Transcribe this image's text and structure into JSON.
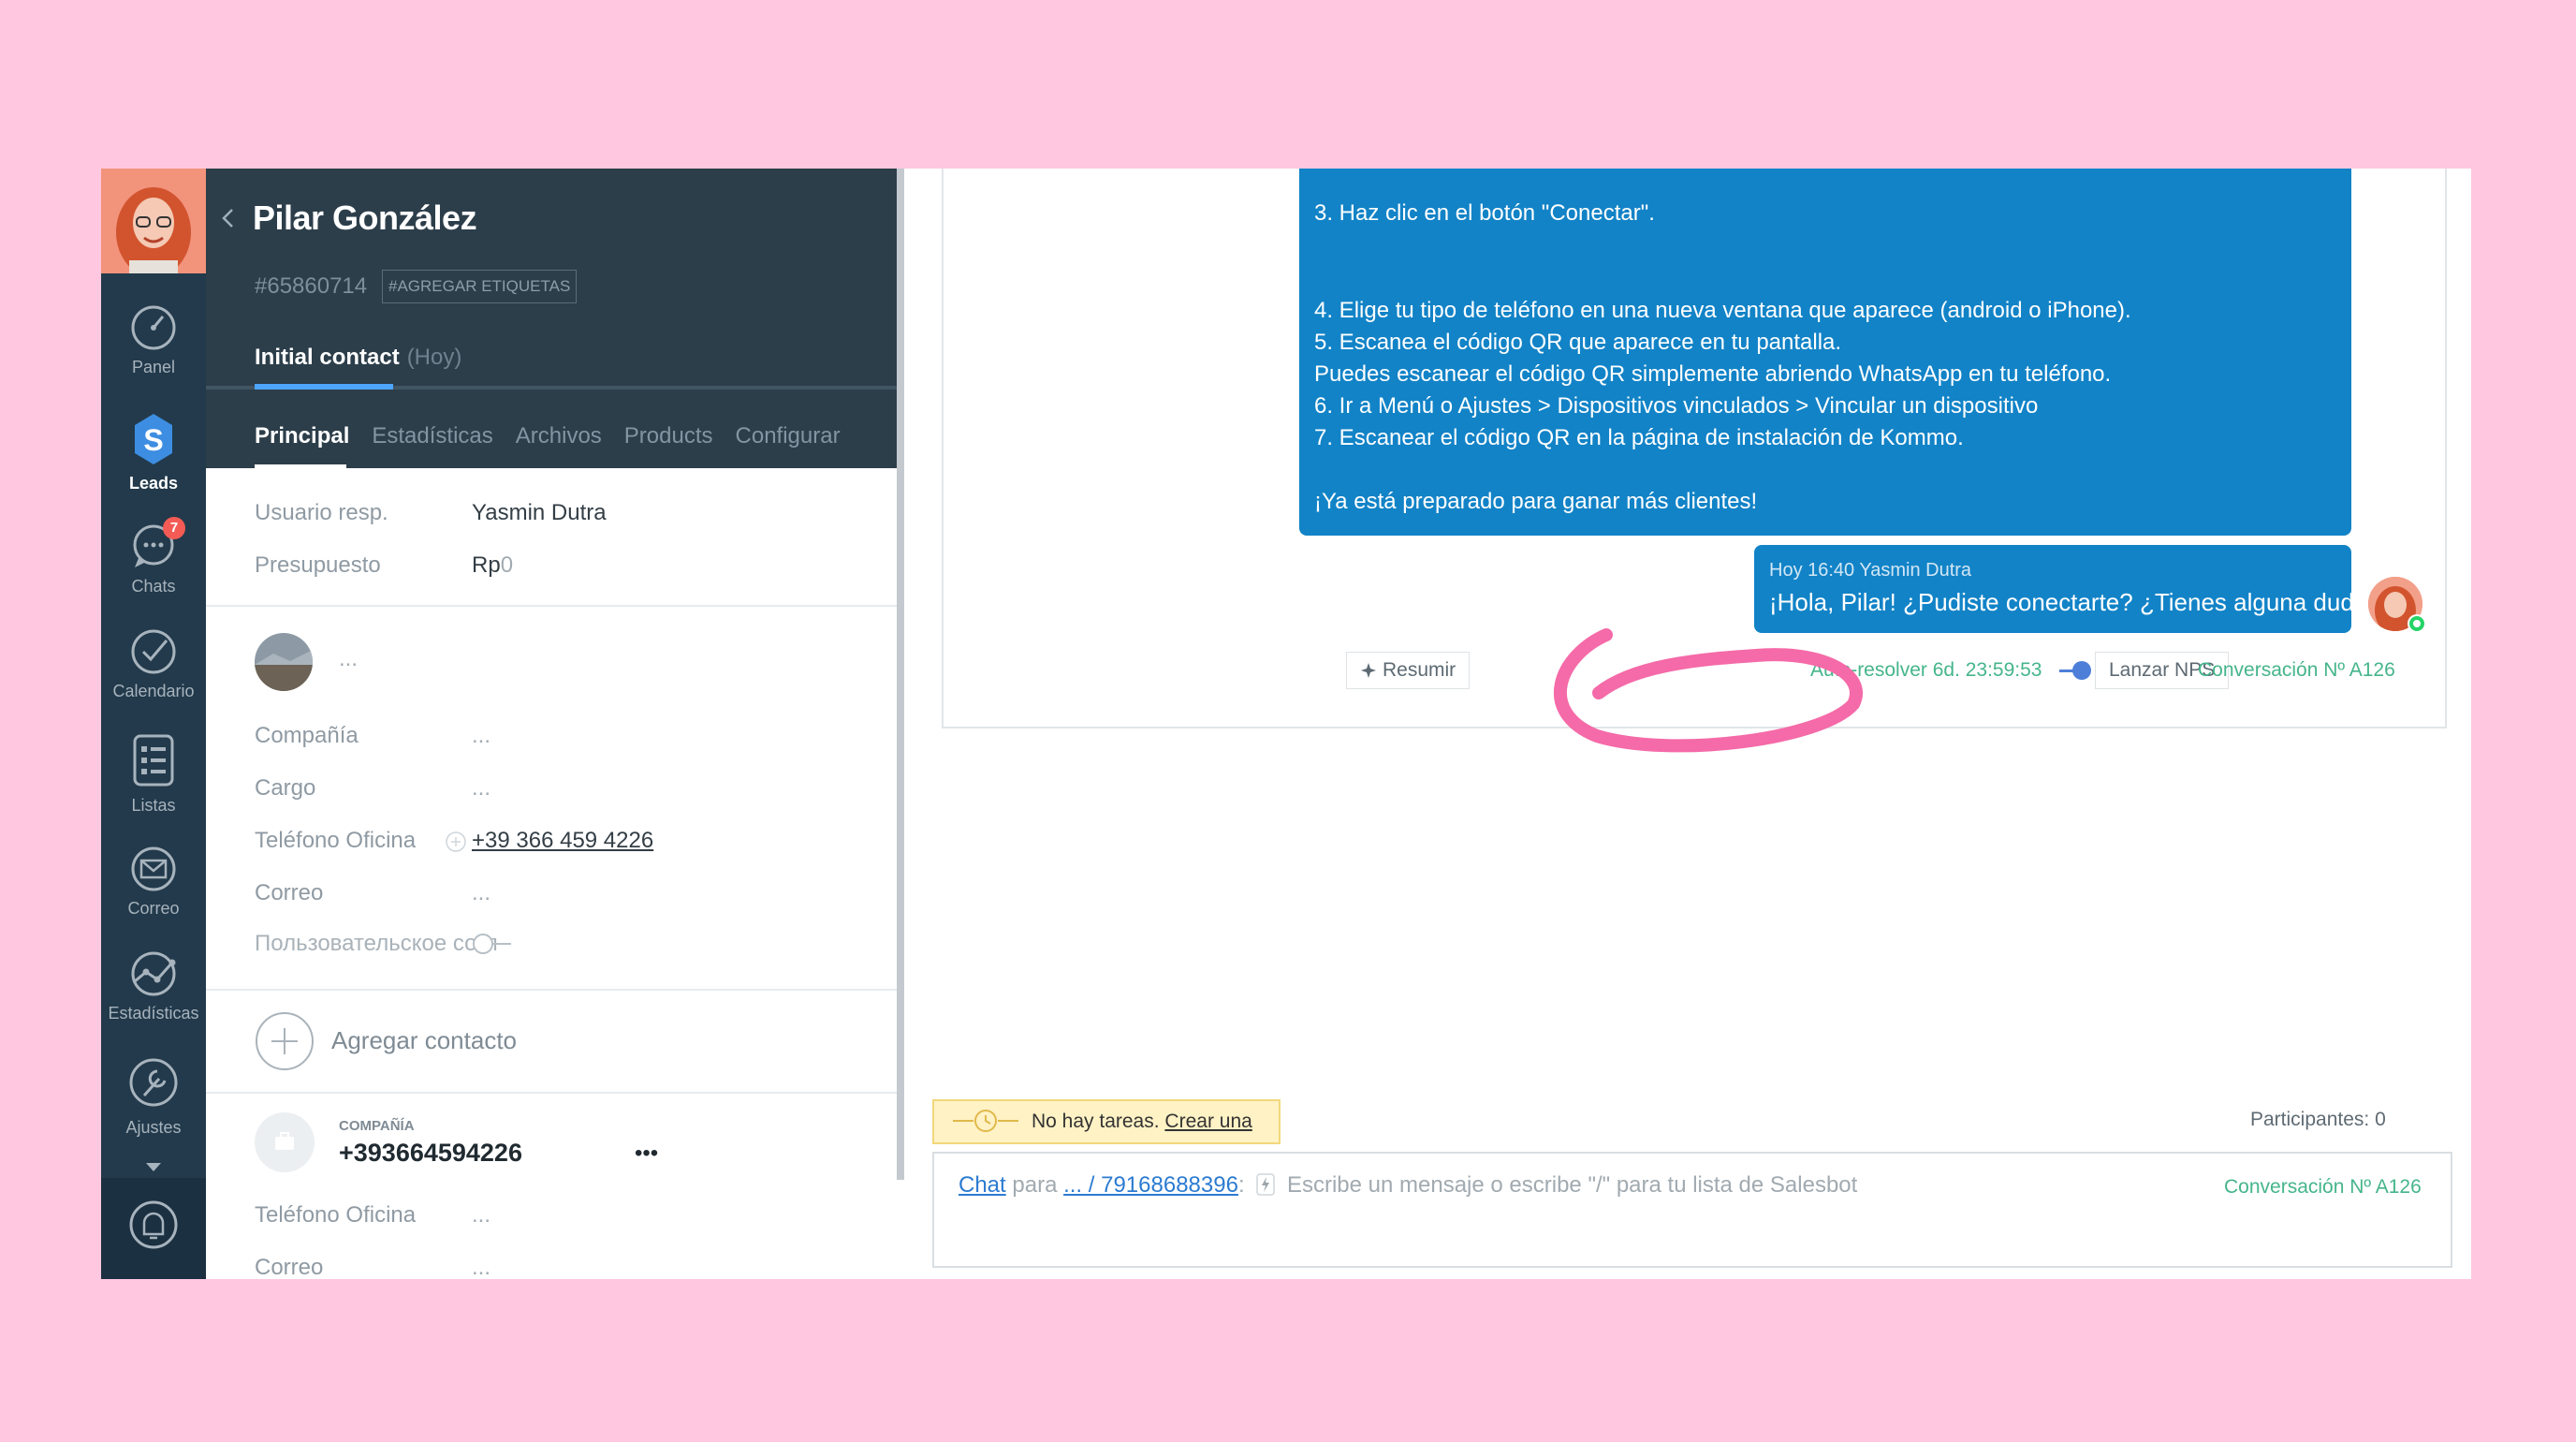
{
  "nav": {
    "items": [
      {
        "label": "Panel",
        "icon": "gauge-icon"
      },
      {
        "label": "Leads",
        "icon": "leads-logo-icon"
      },
      {
        "label": "Chats",
        "icon": "chat-bubble-icon",
        "badge": "7"
      },
      {
        "label": "Calendario",
        "icon": "check-circle-icon"
      },
      {
        "label": "Listas",
        "icon": "list-icon"
      },
      {
        "label": "Correo",
        "icon": "envelope-icon"
      },
      {
        "label": "Estadísticas",
        "icon": "stats-icon"
      },
      {
        "label": "Ajustes",
        "icon": "wrench-icon"
      }
    ],
    "active": "Leads"
  },
  "lead": {
    "name": "Pilar González",
    "id": "#65860714",
    "tags_button": "#AGREGAR ETIQUETAS",
    "status": "Initial contact",
    "status_time": "(Hoy)",
    "tabs": [
      "Principal",
      "Estadísticas",
      "Archivos",
      "Products",
      "Configurar"
    ],
    "active_tab": "Principal",
    "fields": {
      "usuario_label": "Usuario resp.",
      "usuario_value": "Yasmin Dutra",
      "presupuesto_label": "Presupuesto",
      "presupuesto_currency": "Rp",
      "presupuesto_value": "0",
      "contact_more": "...",
      "compania_label": "Compañía",
      "compania_value": "...",
      "cargo_label": "Cargo",
      "cargo_value": "...",
      "telefono_label": "Teléfono Oficina",
      "telefono_value": "+39 366 459 4226",
      "correo_label": "Correo",
      "correo_value": "...",
      "custom_label": "Пользовательское согл"
    },
    "add_contact": "Agregar contacto",
    "company": {
      "caption": "COMPAÑÍA",
      "name": "+393664594226",
      "more": "•••",
      "telefono_label": "Teléfono Oficina",
      "telefono_value": "...",
      "correo_label": "Correo",
      "correo_value": "..."
    }
  },
  "chat": {
    "bot_lines": [
      "3. Haz clic en el botón \"Conectar\".",
      "4. Elige tu tipo de teléfono en una nueva ventana que aparece (android o iPhone).",
      "5. Escanea el código QR que aparece en tu pantalla.",
      "Puedes escanear el código QR simplemente abriendo WhatsApp en tu teléfono.",
      "6. Ir a Menú o Ajustes > Dispositivos vinculados > Vincular un dispositivo",
      "7. Escanear el código QR en la página de instalación de Kommo.",
      "¡Ya está preparado para ganar más clientes!"
    ],
    "my_message": {
      "meta": "Hoy 16:40 Yasmin Dutra",
      "text": "¡Hola, Pilar! ¿Pudiste conectarte? ¿Tienes alguna duda?"
    },
    "actions": {
      "summarize": "Resumir",
      "autoresolve": "Auto-resolver 6d. 23:59:53",
      "nps": "Lanzar NPS",
      "conversation": "Conversación Nº A126"
    },
    "tasks": {
      "text": "No hay tareas.",
      "link": "Crear una"
    },
    "participants": "Participantes: 0",
    "composer": {
      "mode": "Chat",
      "para": "para",
      "recipient": "... / 79168688396",
      "colon": ":",
      "placeholder": "Escribe un mensaje o escribe \"/\" para tu lista de Salesbot",
      "conversation": "Conversación Nº A126"
    }
  },
  "colors": {
    "page_bg": "#ffc8e0",
    "nav_bg": "#223a4b",
    "header_bg": "#2c3e4a",
    "bubble": "#1283c7",
    "accent_green": "#45b58b",
    "highlight_circle": "#f56aa8"
  }
}
